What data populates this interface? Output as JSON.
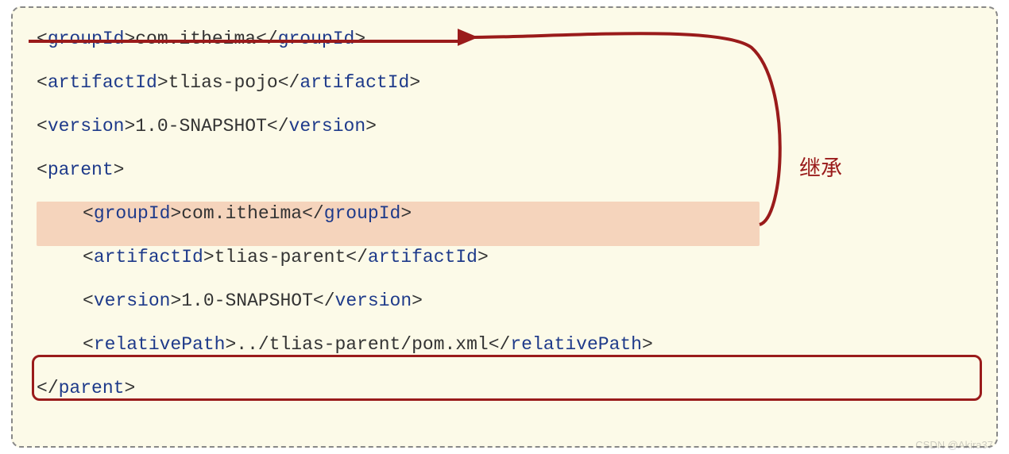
{
  "code": {
    "line1": {
      "tag": "groupId",
      "value": "com.itheima"
    },
    "line2": {
      "tag": "artifactId",
      "value": "tlias-pojo"
    },
    "line3": {
      "tag": "version",
      "value": "1.0-SNAPSHOT"
    },
    "line4": {
      "openTag": "parent"
    },
    "line5": {
      "tag": "groupId",
      "value": "com.itheima"
    },
    "line6": {
      "tag": "artifactId",
      "value": "tlias-parent"
    },
    "line7": {
      "tag": "version",
      "value": "1.0-SNAPSHOT"
    },
    "line8": {
      "tag": "relativePath",
      "value": "../tlias-parent/pom.xml"
    },
    "line9": {
      "closeTag": "parent"
    }
  },
  "annotation": {
    "label": "继承"
  },
  "watermark": "CSDN @Akira37",
  "brackets": {
    "open": "<",
    "close": ">",
    "slash": "/"
  }
}
